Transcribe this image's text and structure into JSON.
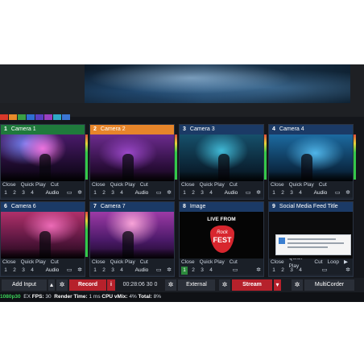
{
  "colors": {
    "swatches": [
      "#d9382a",
      "#e88a2a",
      "#3aa045",
      "#2e6ed1",
      "#5a3fc0",
      "#9a3fbf",
      "#2fa9c8",
      "#3b76d4"
    ]
  },
  "inputs": [
    {
      "num": "1",
      "title": "Camera 1",
      "buttons": [
        "Close",
        "Quick Play",
        "Cut"
      ],
      "audio": "Audio",
      "nums": [
        "1",
        "2",
        "3",
        "4"
      ]
    },
    {
      "num": "2",
      "title": "Camera 2",
      "buttons": [
        "Close",
        "Quick Play",
        "Cut"
      ],
      "audio": "Audio",
      "nums": [
        "1",
        "2",
        "3",
        "4"
      ]
    },
    {
      "num": "3",
      "title": "Camera 3",
      "buttons": [
        "Close",
        "Quick Play",
        "Cut"
      ],
      "audio": "Audio",
      "nums": [
        "1",
        "2",
        "3",
        "4"
      ]
    },
    {
      "num": "4",
      "title": "Camera 4",
      "buttons": [
        "Close",
        "Quick Play",
        "Cut"
      ],
      "audio": "Audio",
      "nums": [
        "1",
        "2",
        "3",
        "4"
      ]
    },
    {
      "num": "6",
      "title": "Camera 6",
      "buttons": [
        "Close",
        "Quick Play",
        "Cut"
      ],
      "audio": "Audio",
      "nums": [
        "1",
        "2",
        "3",
        "4"
      ]
    },
    {
      "num": "7",
      "title": "Camera 7",
      "buttons": [
        "Close",
        "Quick Play",
        "Cut"
      ],
      "audio": "Audio",
      "nums": [
        "1",
        "2",
        "3",
        "4"
      ]
    },
    {
      "num": "8",
      "title": "Image",
      "buttons": [
        "Close",
        "Quick Play",
        "Cut"
      ],
      "audio": "",
      "nums": [
        "1",
        "2",
        "3",
        "4"
      ]
    },
    {
      "num": "9",
      "title": "Social Media Feed Title",
      "buttons": [
        "Close",
        "Quick Play",
        "Cut",
        "Loop"
      ],
      "audio": "",
      "nums": [
        "1",
        "2",
        "3",
        "4"
      ]
    }
  ],
  "image_input": {
    "live_from": "LIVE FROM",
    "rock": "Rock",
    "fest": "FEST"
  },
  "toolbar": {
    "add_input": "Add Input",
    "record": "Record",
    "record_info": "i",
    "timecode": "00:28:06 30 0",
    "external": "External",
    "stream": "Stream",
    "multicorder": "MultiCorder"
  },
  "status": {
    "resolution": "1080p30",
    "ex": "EX",
    "fps_label": "FPS:",
    "fps": "30",
    "render_label": "Render Time:",
    "render": "1 ms",
    "cpu_label": "CPU vMix:",
    "cpu": "4%",
    "total_label": "Total:",
    "total": "8%"
  }
}
